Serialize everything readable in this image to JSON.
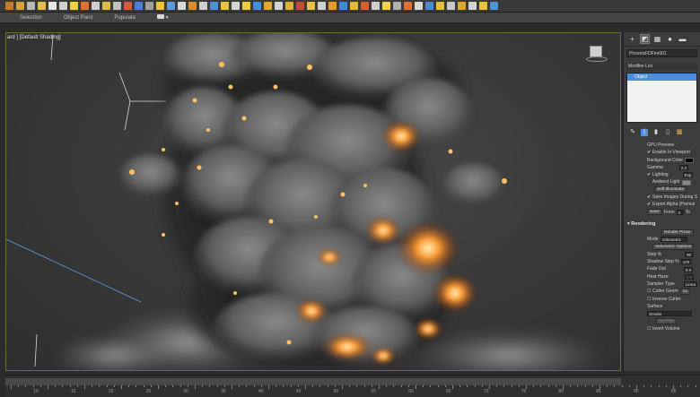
{
  "ribbon": {
    "items": [
      "Selection",
      "Object Paint",
      "Populate"
    ]
  },
  "viewport": {
    "label": "ard ] [Default Shading]"
  },
  "command_panel": {
    "object_name": "PhoenixFDFire001",
    "modifier_list_label": "Modifier List",
    "stack_selected": "Object",
    "gpu_preview": {
      "header": "GPU Preview",
      "enable_in_viewport": "Enable In Viewport",
      "background_color": "Background Color",
      "gamma_label": "Gamma",
      "gamma_value": "2.2",
      "lighting": "Lighting",
      "lighting_mode": "Exp",
      "ambient_light": "Ambient Light",
      "self_illuminate": "Self Illuminate",
      "save_images": "Save Images During S",
      "export_alpha": "Export Alpha (Premul",
      "save_label": "Save",
      "from_label": "From",
      "from_value": "0",
      "to_label": "To"
    },
    "rendering": {
      "header": "Rendering",
      "render_preset": "Render Prese",
      "mode_label": "Mode",
      "mode_value": "Volumetric",
      "volumetric_options": "Volumetric Options",
      "step_label": "Step %",
      "step_value": "90",
      "shadow_step_label": "Shadow Step %",
      "shadow_step_value": "100",
      "fade_out_label": "Fade Out",
      "fade_out_value": "0.0",
      "heat_haze_label": "Heat Haze",
      "heat_haze_value": "1.0",
      "sampler_label": "Sampler Type",
      "sampler_value": "Linea",
      "cutter_geom": "Cutter Geom",
      "cutter_geom_value": "Sc",
      "inverse_cutter": "Inverse Cutter",
      "surface_label": "Surface",
      "smoke_value": "Smoke",
      "no_plus": "No Plus",
      "invert_volume": "Invert Volume"
    }
  },
  "timeline": {
    "tick_labels": [
      "10",
      "15",
      "20",
      "25",
      "30",
      "35",
      "40",
      "45",
      "50",
      "55",
      "60",
      "65",
      "70",
      "75",
      "80",
      "85",
      "90",
      "95"
    ]
  },
  "colors": {
    "viewport_border": "#6b6b3a",
    "selection_blue": "#4a90d9",
    "fire_orange": "#ff9a2e"
  }
}
